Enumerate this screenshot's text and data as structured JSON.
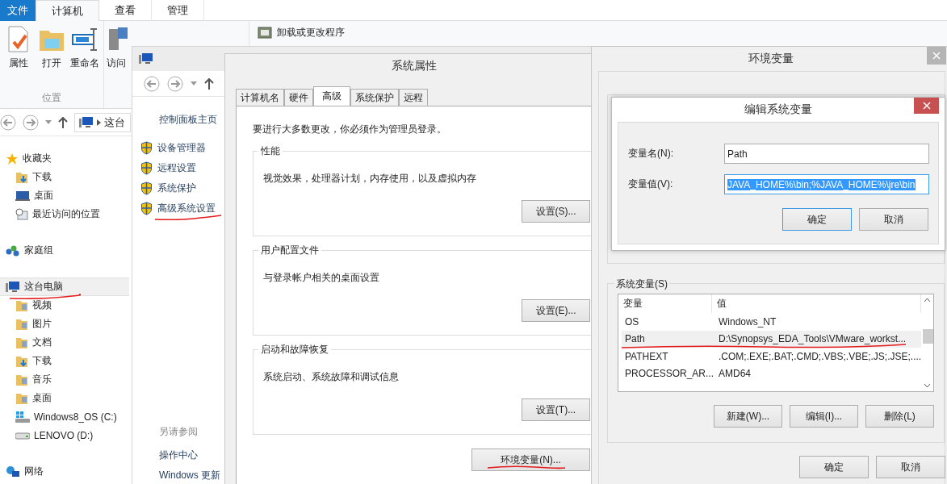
{
  "explorer": {
    "ribbon_tabs": [
      {
        "label": "文件",
        "kind": "file",
        "selected": false
      },
      {
        "label": "计算机",
        "kind": "tab",
        "selected": true
      },
      {
        "label": "查看",
        "kind": "tab",
        "selected": false
      },
      {
        "label": "管理",
        "kind": "tab",
        "selected": false
      }
    ],
    "location_group": {
      "label": "位置",
      "buttons": [
        {
          "label": "属性",
          "kind": "properties"
        },
        {
          "label": "打开",
          "kind": "open"
        },
        {
          "label": "重命名",
          "kind": "rename"
        }
      ]
    },
    "media_button": "访问",
    "program_link": "卸载或更改程序",
    "address": "这台",
    "nav": [
      {
        "label": "收藏夹",
        "kind": "star",
        "selected": false,
        "children": [
          {
            "label": "下载",
            "kind": "download"
          },
          {
            "label": "桌面",
            "kind": "desktop"
          },
          {
            "label": "最近访问的位置",
            "kind": "recent"
          }
        ]
      },
      {
        "label": "家庭组",
        "kind": "homegroup",
        "selected": false
      },
      {
        "label": "这台电脑",
        "kind": "computer",
        "selected": true,
        "children": [
          {
            "label": "视频",
            "kind": "folder"
          },
          {
            "label": "图片",
            "kind": "folder"
          },
          {
            "label": "文档",
            "kind": "folder"
          },
          {
            "label": "下载",
            "kind": "download"
          },
          {
            "label": "音乐",
            "kind": "folder"
          },
          {
            "label": "桌面",
            "kind": "folder"
          },
          {
            "label": "Windows8_OS (C:)",
            "kind": "windrive"
          },
          {
            "label": "LENOVO (D:)",
            "kind": "drive"
          }
        ]
      },
      {
        "label": "网络",
        "kind": "network",
        "selected": false
      }
    ]
  },
  "control_panel": {
    "home_link": "控制面板主页",
    "links": [
      "设备管理器",
      "远程设置",
      "系统保护",
      "高级系统设置"
    ],
    "see_also": {
      "heading": "另请参阅",
      "links": [
        "操作中心",
        "Windows 更新"
      ]
    }
  },
  "system_properties": {
    "title": "系统属性",
    "tabs": [
      {
        "label": "计算机名",
        "selected": false
      },
      {
        "label": "硬件",
        "selected": false
      },
      {
        "label": "高级",
        "selected": true
      },
      {
        "label": "系统保护",
        "selected": false
      },
      {
        "label": "远程",
        "selected": false
      }
    ],
    "notice": "要进行大多数更改，你必须作为管理员登录。",
    "groups": [
      {
        "title": "性能",
        "description": "视觉效果，处理器计划，内存使用，以及虚拟内存",
        "button": "设置(S)..."
      },
      {
        "title": "用户配置文件",
        "description": "与登录帐户相关的桌面设置",
        "button": "设置(E)..."
      },
      {
        "title": "启动和故障恢复",
        "description": "系统启动、系统故障和调试信息",
        "button": "设置(T)..."
      }
    ],
    "env_button": "环境变量(N)..."
  },
  "environment_variables": {
    "title": "环境变量",
    "system_vars": {
      "label": "系统变量(S)",
      "columns": [
        "变量",
        "值"
      ],
      "rows": [
        {
          "name": "OS",
          "value": "Windows_NT",
          "selected": false
        },
        {
          "name": "Path",
          "value": "D:\\Synopsys_EDA_Tools\\VMware_workst...",
          "selected": true
        },
        {
          "name": "PATHEXT",
          "value": ".COM;.EXE;.BAT;.CMD;.VBS;.VBE;.JS;.JSE;....",
          "selected": false
        },
        {
          "name": "PROCESSOR_AR...",
          "value": "AMD64",
          "selected": false
        }
      ],
      "buttons": [
        "新建(W)...",
        "编辑(I)...",
        "删除(L)"
      ]
    },
    "footer_buttons": [
      "确定",
      "取消"
    ]
  },
  "edit_dialog": {
    "title": "编辑系统变量",
    "fields": [
      {
        "label": "变量名(N):",
        "value": "Path",
        "selected": false
      },
      {
        "label": "变量值(V):",
        "value": "JAVA_HOME%\\bin;%JAVA_HOME%\\jre\\bin",
        "selected": true
      }
    ],
    "buttons": [
      {
        "label": "确定",
        "default": true
      },
      {
        "label": "取消",
        "default": false
      }
    ]
  }
}
